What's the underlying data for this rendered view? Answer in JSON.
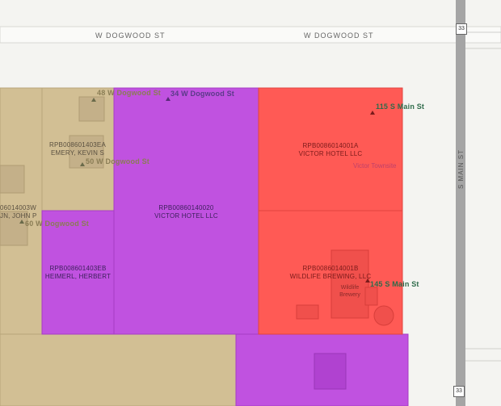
{
  "roads": {
    "dogwood_left": "W DOGWOOD ST",
    "dogwood_right": "W DOGWOOD ST",
    "main": "S MAIN ST",
    "shield_top": "33",
    "shield_bottom": "33"
  },
  "addresses": {
    "a48": "48 W Dogwood St",
    "a34": "34 W Dogwood St",
    "a50": "50 W Dogwood St",
    "a60": "60 W Dogwood St",
    "a115": "115 S Main St",
    "a145": "145 S Main St"
  },
  "parcels": {
    "p1403ea_id": "RPB008601403EA",
    "p1403ea_owner": "EMERY, KEVIN S",
    "p1403w_id": "06014003W",
    "p1403w_owner": "JN, JOHN P",
    "p1403eb_id": "RPB008601403EB",
    "p1403eb_owner": "HEIMERL, HERBERT",
    "p0020_id": "RPB00860140020",
    "p0020_owner": "VICTOR HOTEL LLC",
    "p001a_id": "RPB0086014001A",
    "p001a_owner": "VICTOR HOTEL LLC",
    "p001b_id": "RPB0086014001B",
    "p001b_owner": "WILDLIFE BREWING, LLC"
  },
  "places": {
    "townsite": "Victor Townsite",
    "brewery_line1": "Wildlife",
    "brewery_line2": "Brewery"
  },
  "colors": {
    "tan": "#d2bf94",
    "purple": "#c052e0",
    "red": "#ff5a55"
  }
}
